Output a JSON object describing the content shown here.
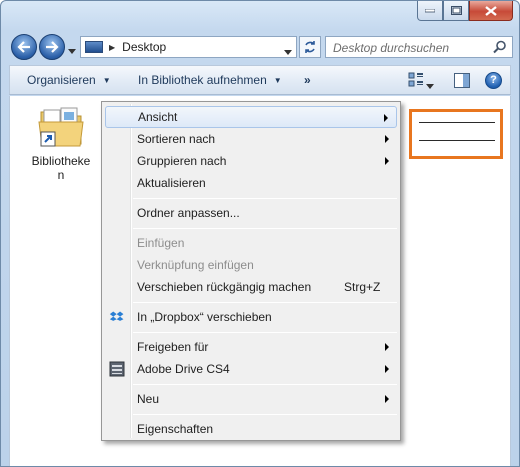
{
  "window": {
    "caption_buttons": [
      "minimize",
      "maximize",
      "close"
    ]
  },
  "navigation": {
    "address_path": "Desktop",
    "search_placeholder": "Desktop durchsuchen"
  },
  "toolbar": {
    "organize_label": "Organisieren",
    "library_label": "In Bibliothek aufnehmen",
    "more_label": "»"
  },
  "desktop_items": [
    {
      "label": "Bibliotheken",
      "icon": "libraries-folder-icon"
    }
  ],
  "context_menu": {
    "items": [
      {
        "label": "Ansicht",
        "submenu": true,
        "highlighted": true
      },
      {
        "label": "Sortieren nach",
        "submenu": true
      },
      {
        "label": "Gruppieren nach",
        "submenu": true
      },
      {
        "label": "Aktualisieren"
      },
      {
        "label": "Ordner anpassen..."
      },
      {
        "label": "Einfügen",
        "disabled": true
      },
      {
        "label": "Verknüpfung einfügen",
        "disabled": true
      },
      {
        "label": "Verschieben rückgängig machen",
        "shortcut": "Strg+Z"
      },
      {
        "label": "In „Dropbox“ verschieben",
        "icon": "dropbox-icon"
      },
      {
        "label": "Freigeben für",
        "submenu": true
      },
      {
        "label": "Adobe Drive CS4",
        "submenu": true,
        "icon": "adobe-drive-icon"
      },
      {
        "label": "Neu",
        "submenu": true
      },
      {
        "label": "Eigenschaften"
      }
    ]
  },
  "colors": {
    "highlight_border": "#e8761f",
    "menu_background": "#f0f0f0"
  }
}
